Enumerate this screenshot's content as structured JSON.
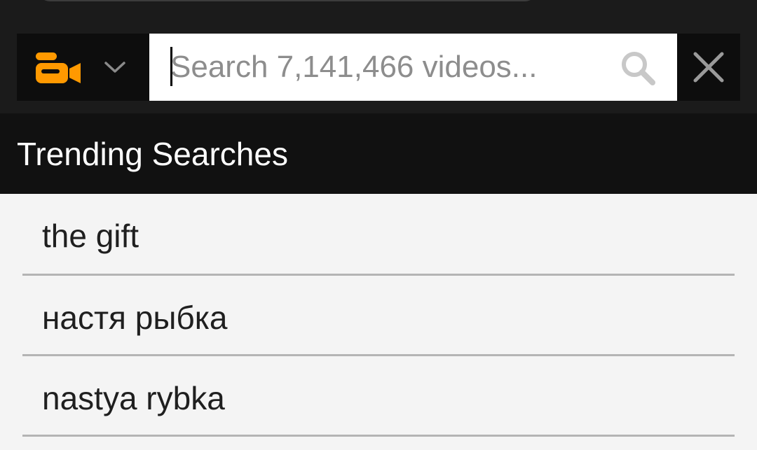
{
  "search": {
    "placeholder": "Search 7,141,466 videos..."
  },
  "type_selector": {
    "icon": "video-camera-icon",
    "accent_color": "#ff9900"
  },
  "trending": {
    "title": "Trending Searches",
    "items": [
      {
        "label": "the gift"
      },
      {
        "label": "настя рыбка"
      },
      {
        "label": "nastya rybka"
      }
    ]
  },
  "colors": {
    "header_bg": "#1b1b1b",
    "trending_header_bg": "#111111",
    "list_bg": "#f4f4f4",
    "divider": "#b4b4b4"
  }
}
